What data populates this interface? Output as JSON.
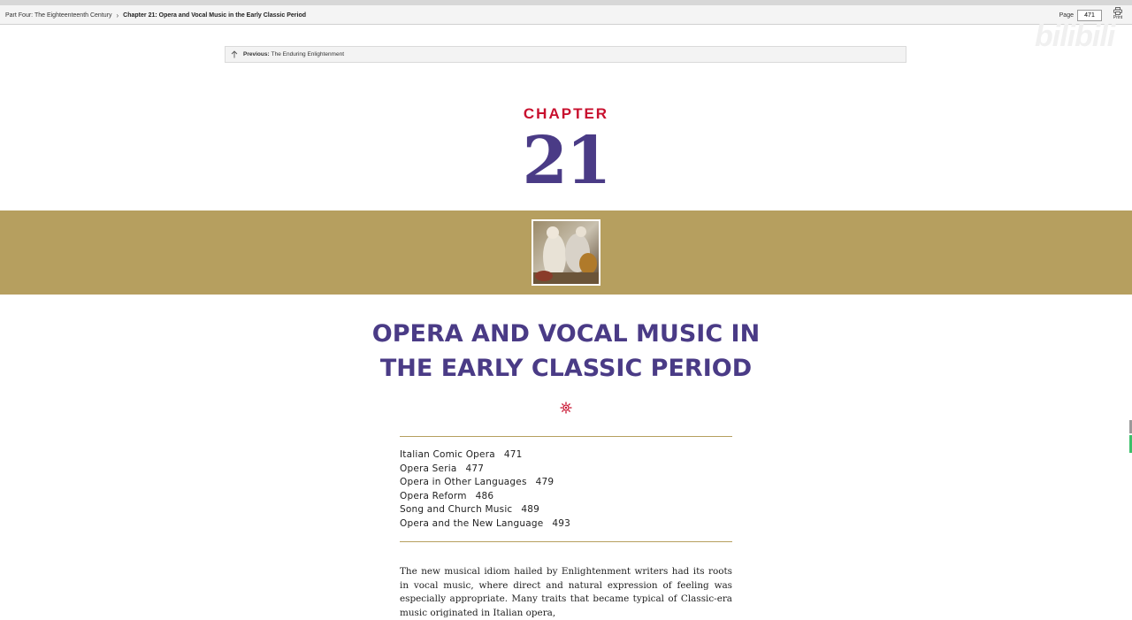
{
  "toolbar": {
    "breadcrumb_part": "Part Four: The Eighteenteenth Century",
    "breadcrumb_separator": "›",
    "breadcrumb_chapter": "Chapter 21: Opera and Vocal Music in the Early Classic Period",
    "page_label": "Page",
    "page_value": "471",
    "print_label": "Print",
    "print_icon": "printer-icon"
  },
  "previous": {
    "icon": "arrow-up-icon",
    "label": "Previous:",
    "title": "The Enduring Enlightenment"
  },
  "watermark": "bilibili",
  "chapter": {
    "label": "CHAPTER",
    "number": "21"
  },
  "title_line1": "OPERA AND VOCAL MUSIC IN",
  "title_line2": "THE EARLY CLASSIC PERIOD",
  "toc": [
    {
      "title": "Italian Comic Opera",
      "page": "471"
    },
    {
      "title": "Opera Seria",
      "page": "477"
    },
    {
      "title": "Opera in Other Languages",
      "page": "479"
    },
    {
      "title": "Opera Reform",
      "page": "486"
    },
    {
      "title": "Song and Church Music",
      "page": "489"
    },
    {
      "title": "Opera and the New Language",
      "page": "493"
    }
  ],
  "body_paragraph": "The new musical idiom hailed by Enlightenment writers had its roots in vocal music, where direct and natural expression of feeling was especially appropriate. Many traits that became typical of Classic-era music originated in Italian opera,",
  "colors": {
    "accent_red": "#c8102e",
    "accent_purple": "#4a3b86",
    "band_gold": "#b69f5f"
  }
}
